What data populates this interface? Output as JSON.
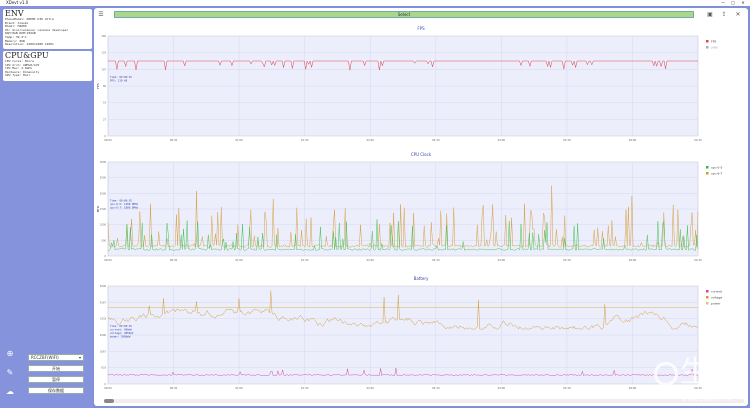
{
  "app": {
    "title": "XDevt v1.0",
    "controls": [
      "—",
      "□",
      "✕"
    ]
  },
  "env": {
    "heading": "ENV",
    "lines": [
      "PhoneModel: REDMI K30 Ultra",
      "Brand: Xiaomi",
      "Model: M2006",
      "OS: miui/cezanne/ cezanne developer",
      "RAM:8GB  ROM:256GB",
      "Temp: 39.2°C",
      "Memory: 8GB",
      "Resolution: 2400x1080 120Hz"
    ]
  },
  "cpu": {
    "heading": "CPU&GPU",
    "lines": [
      "CPU Cores: 8Core",
      "CPU Arch: ARMv8/A76",
      "CPU Max: 2.6GHz",
      "Hardware: Dimensity",
      "GPU Type: Mali"
    ]
  },
  "controls": {
    "device": "RCCZBF(WIFI)",
    "buttons": [
      "开始",
      "暂停",
      "保存数据"
    ]
  },
  "sidebar_icons": [
    "plus-circle-icon",
    "wrench-icon",
    "cloud-upload-icon"
  ],
  "topbar": {
    "select_label": "Select",
    "left_icon": "menu-icon",
    "right_icons": [
      "save-icon",
      "export-icon",
      "close-icon"
    ]
  },
  "colors": {
    "fps": "#e2434b",
    "cpu0": "#33bb44",
    "cpu7": "#d4972f",
    "current": "#d040a8",
    "voltage": "#d4972f",
    "power": "#e0c070",
    "plot_bg": "#eceefc",
    "grid": "#cfd3ef"
  },
  "chart_data": [
    {
      "type": "line",
      "title": "FPS",
      "ylabel": "FPS",
      "ylim": [
        0,
        160
      ],
      "baseline": 120,
      "series": [
        {
          "name": "FPS",
          "color": "#e2434b"
        }
      ],
      "legend": [
        "FPS",
        "JANK"
      ],
      "tooltip": [
        "Time: 00:00:35",
        "FPS: 119.48"
      ],
      "x_ticks": [
        "00:00",
        "00:30",
        "01:00",
        "01:30",
        "02:00",
        "02:30",
        "03:00",
        "03:30",
        "04:00",
        "04:30"
      ]
    },
    {
      "type": "line",
      "title": "CPU Clock",
      "ylabel": "MHz",
      "ylim": [
        0,
        3000
      ],
      "series": [
        {
          "name": "cpu-0-5",
          "color": "#33bb44"
        },
        {
          "name": "cpu-6-7",
          "color": "#d4972f"
        }
      ],
      "tooltip": [
        "Time: 00:00:35",
        "cpu-0-5: 1200.0MHz",
        "cpu-6-7: 1800.0MHz"
      ],
      "x_ticks": [
        "00:00",
        "00:30",
        "01:00",
        "01:30",
        "02:00",
        "02:30",
        "03:00",
        "03:30",
        "04:00",
        "04:30"
      ]
    },
    {
      "type": "line",
      "title": "Battery",
      "ylim": [
        0,
        5000
      ],
      "series": [
        {
          "name": "current",
          "color": "#d040a8"
        },
        {
          "name": "voltage",
          "color": "#d4972f"
        },
        {
          "name": "power",
          "color": "#e0c070"
        }
      ],
      "tooltip": [
        "Time: 00:00:35",
        "current: 400mA",
        "voltage: 3850mV",
        "power: 3900mW"
      ],
      "x_ticks": [
        "00:00",
        "00:30",
        "01:00",
        "01:30",
        "02:00",
        "02:30",
        "03:00",
        "03:30",
        "04:00",
        "04:30"
      ]
    }
  ],
  "watermark": {
    "text": "生活",
    "url": "www.zealfe.net"
  }
}
